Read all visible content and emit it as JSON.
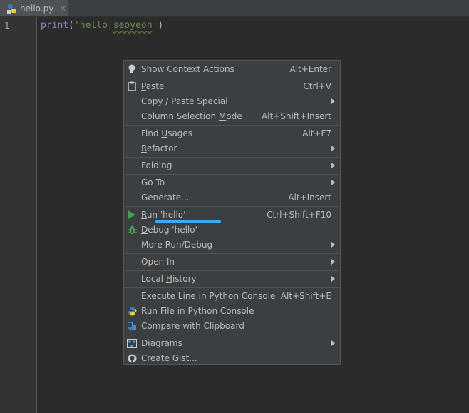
{
  "tab": {
    "filename": "hello.py",
    "close_glyph": "×"
  },
  "gutter": {
    "line_number": "1"
  },
  "code": {
    "fn": "print",
    "open": "(",
    "str_quote_open": "'",
    "str_text_a": "hello ",
    "str_text_b": "seoyeon",
    "str_quote_close": "'",
    "close": ")"
  },
  "menu": {
    "show_context_actions": {
      "label": "Show Context Actions",
      "shortcut": "Alt+Enter",
      "icon": "lightbulb-icon"
    },
    "paste": {
      "label_pre": "",
      "label_u": "P",
      "label_post": "aste",
      "shortcut": "Ctrl+V",
      "icon": "clipboard-icon"
    },
    "copy_paste_special": {
      "label": "Copy / Paste Special"
    },
    "column_selection": {
      "label_pre": "Column Selection ",
      "label_u": "M",
      "label_post": "ode",
      "shortcut": "Alt+Shift+Insert"
    },
    "find_usages": {
      "label_pre": "Find ",
      "label_u": "U",
      "label_post": "sages",
      "shortcut": "Alt+F7"
    },
    "refactor": {
      "label_pre": "",
      "label_u": "R",
      "label_post": "efactor"
    },
    "folding": {
      "label": "Folding"
    },
    "go_to": {
      "label": "Go To"
    },
    "generate": {
      "label": "Generate...",
      "shortcut": "Alt+Insert"
    },
    "run": {
      "label_pre": "",
      "label_u": "R",
      "label_post": "un 'hello'",
      "shortcut": "Ctrl+Shift+F10",
      "icon": "run-triangle-icon"
    },
    "debug": {
      "label_pre": "",
      "label_u": "D",
      "label_post": "ebug 'hello'",
      "icon": "bug-icon"
    },
    "more_run_debug": {
      "label": "More Run/Debug"
    },
    "open_in": {
      "label": "Open In"
    },
    "local_history": {
      "label_pre": "Local ",
      "label_u": "H",
      "label_post": "istory"
    },
    "execute_line": {
      "label": "Execute Line in Python Console",
      "shortcut": "Alt+Shift+E"
    },
    "run_file": {
      "label": "Run File in Python Console",
      "icon": "python-icon"
    },
    "compare_clipboard": {
      "label_pre": "Compare with Clip",
      "label_u": "b",
      "label_post": "oard",
      "icon": "compare-icon"
    },
    "diagrams": {
      "label": "Diagrams",
      "icon": "diagram-icon"
    },
    "create_gist": {
      "label": "Create Gist...",
      "icon": "github-icon"
    }
  },
  "colors": {
    "editor_bg": "#2b2b2b",
    "menu_bg": "#3c3f41",
    "run_green": "#499c54",
    "annotation_blue": "#3fa9f5"
  }
}
